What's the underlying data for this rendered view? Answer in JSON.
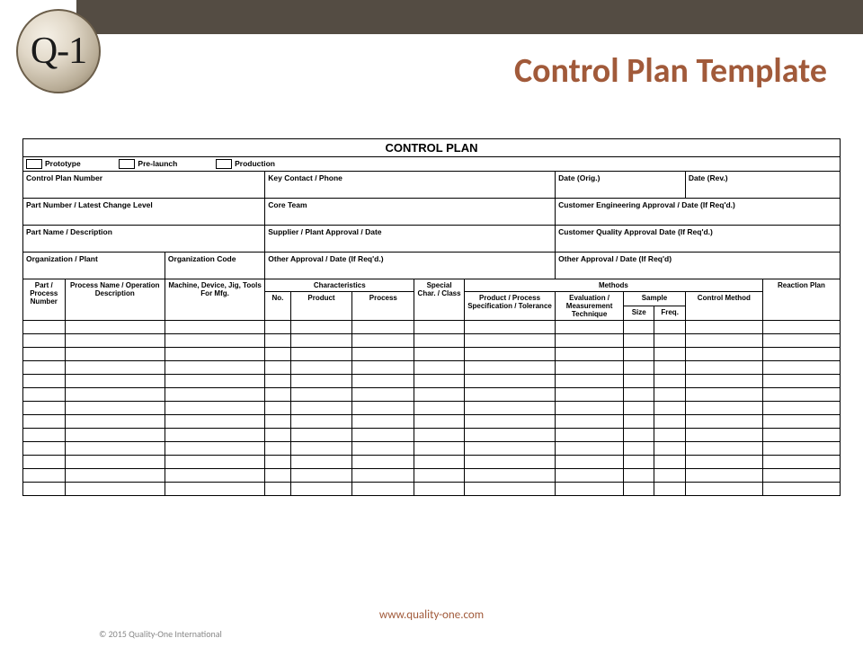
{
  "brand": {
    "logo_text": "Q-1"
  },
  "page_title": "Control Plan Template",
  "plan": {
    "title": "CONTROL PLAN",
    "checkboxes": {
      "prototype": "Prototype",
      "prelaunch": "Pre-launch",
      "production": "Production"
    },
    "info": {
      "control_plan_number": "Control Plan Number",
      "key_contact": "Key Contact / Phone",
      "date_orig": "Date (Orig.)",
      "date_rev": "Date (Rev.)",
      "part_number": "Part Number / Latest Change Level",
      "core_team": "Core Team",
      "cust_eng": "Customer Engineering Approval / Date (If Req'd.)",
      "part_name": "Part Name / Description",
      "supplier_approval": "Supplier / Plant Approval / Date",
      "cust_quality": "Customer Quality Approval Date (If Req'd.)",
      "org_plant": "Organization / Plant",
      "org_code": "Organization Code",
      "other_approval_1": "Other Approval / Date (If Req'd.)",
      "other_approval_2": "Other Approval / Date (If Req'd)"
    },
    "columns": {
      "part_process_number": "Part / Process Number",
      "process_name": "Process Name / Operation Description",
      "machine": "Machine, Device, Jig, Tools For Mfg.",
      "characteristics": "Characteristics",
      "char_no": "No.",
      "char_product": "Product",
      "char_process": "Process",
      "special_char": "Special Char. / Class",
      "methods": "Methods",
      "product_spec": "Product / Process Specification / Tolerance",
      "evaluation": "Evaluation / Measurement Technique",
      "sample": "Sample",
      "sample_size": "Size",
      "sample_freq": "Freq.",
      "control_method": "Control Method",
      "reaction_plan": "Reaction Plan"
    }
  },
  "footer": {
    "url": "www.quality-one.com",
    "copyright": "© 2015 Quality-One International"
  }
}
